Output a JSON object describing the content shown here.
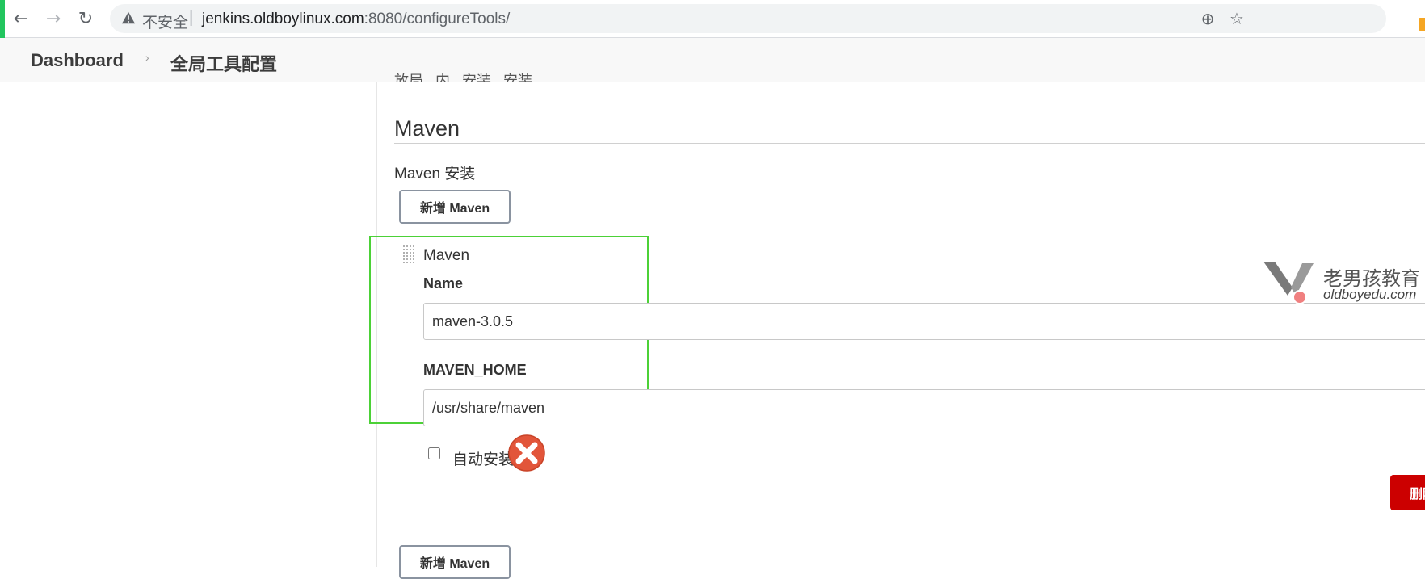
{
  "browser": {
    "insecure_label": "不安全",
    "separator": "|",
    "url_host": "jenkins.oldboylinux.com",
    "url_rest": ":8080/configureTools/"
  },
  "breadcrumb": {
    "dashboard": "Dashboard",
    "chevron": "›",
    "page": "全局工具配置"
  },
  "content": {
    "cut_text": "放局 , 内 . 安装 . 安装",
    "section_title": "Maven",
    "install_label": "Maven 安装",
    "add_button_label": "新增 Maven",
    "item": {
      "title": "Maven",
      "name_label": "Name",
      "name_value": "maven-3.0.5",
      "home_label": "MAVEN_HOME",
      "home_value": "/usr/share/maven",
      "auto_install_label": "自动安装",
      "auto_install_checked": false,
      "delete_label": "删除"
    }
  },
  "watermark": {
    "cn": "老男孩教育",
    "en": "oldboyedu.com"
  },
  "colors": {
    "highlight_border": "#4cd137",
    "delete_bg": "#cc0000",
    "error_icon": "#e2553a"
  }
}
